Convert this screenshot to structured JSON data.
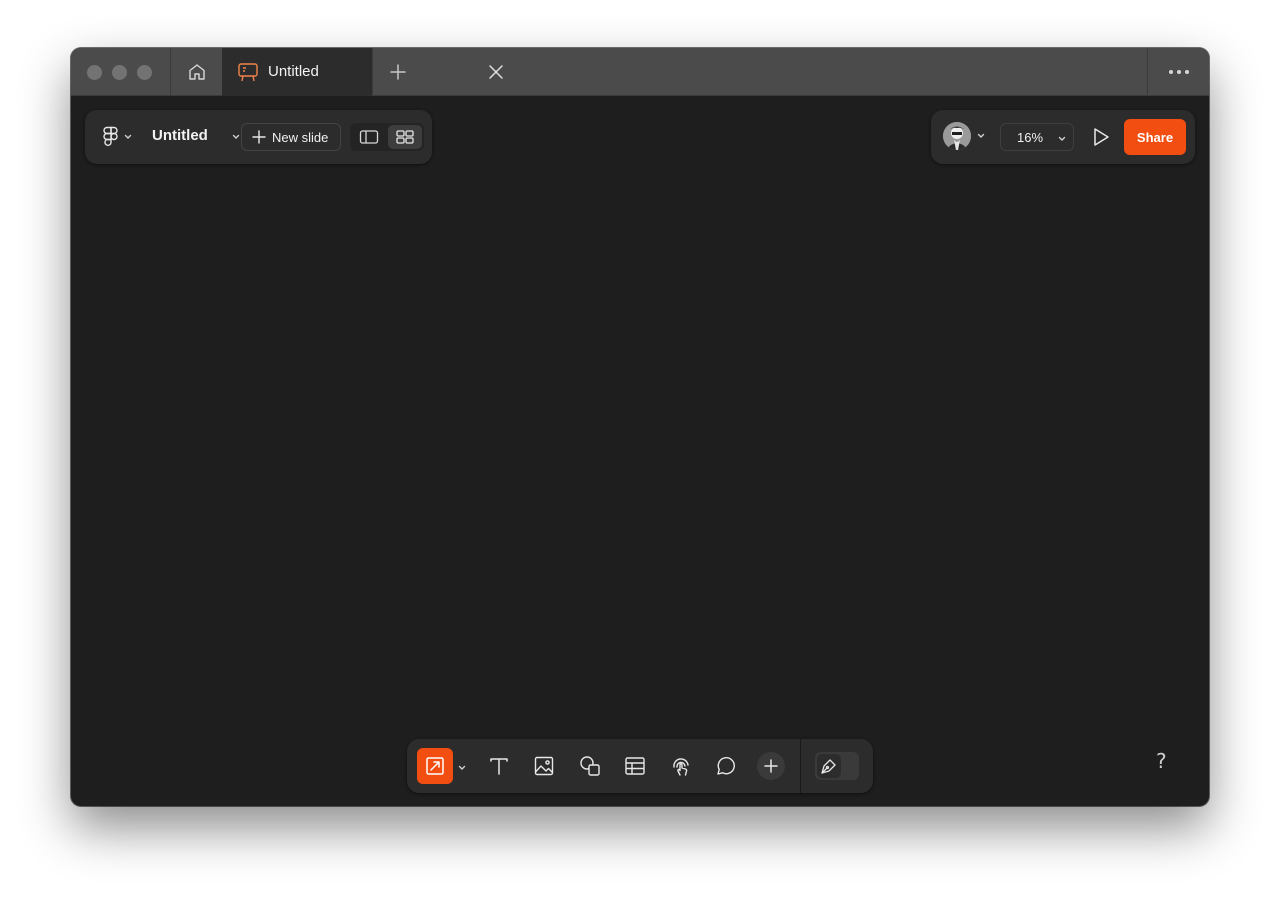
{
  "tab": {
    "title": "Untitled"
  },
  "file": {
    "name": "Untitled"
  },
  "toolbar_top": {
    "new_slide_label": "New slide"
  },
  "zoom": {
    "value": "16%"
  },
  "share": {
    "label": "Share"
  },
  "help": {
    "label": "?"
  },
  "colors": {
    "accent": "#f24e12",
    "canvas": "#1e1e1e",
    "panel": "#2c2c2c",
    "tabbar": "#4b4b4b"
  },
  "bottom_tools": [
    {
      "name": "smart-selection-tool",
      "icon": "arrow-box-icon",
      "active": true
    },
    {
      "name": "text-tool",
      "icon": "text-icon"
    },
    {
      "name": "image-tool",
      "icon": "image-icon"
    },
    {
      "name": "shape-tool",
      "icon": "shapes-icon"
    },
    {
      "name": "table-tool",
      "icon": "table-icon"
    },
    {
      "name": "interactive-tool",
      "icon": "touch-icon"
    },
    {
      "name": "comment-tool",
      "icon": "comment-icon"
    },
    {
      "name": "more-tools",
      "icon": "plus-icon"
    }
  ]
}
